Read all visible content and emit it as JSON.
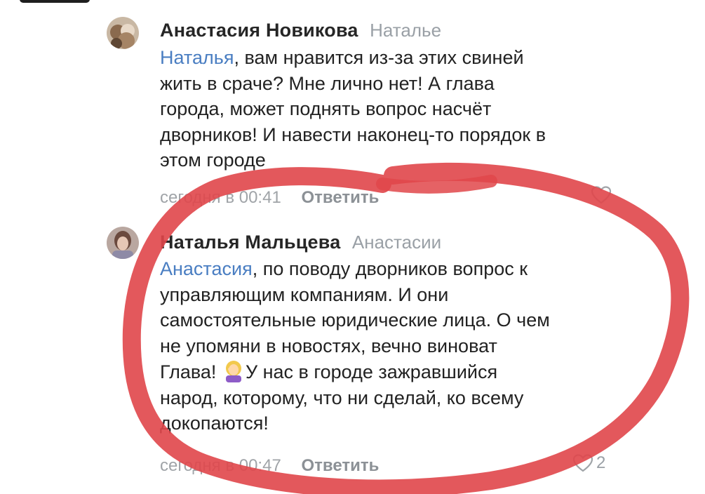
{
  "comments": [
    {
      "author": "Анастасия Новикова",
      "reply_to": "Наталье",
      "mention": "Наталья",
      "lines_first": ", вам нравится из-за этих свиней",
      "lines": [
        "жить в сраче? Мне лично нет! А глава",
        "города, может поднять вопрос насчёт",
        "дворников! И навести наконец-то порядок в",
        "этом городе"
      ],
      "timestamp": "сегодня в 00:41",
      "reply_label": "Ответить",
      "likes": ""
    },
    {
      "author": "Наталья Мальцева",
      "reply_to": "Анастасии",
      "mention": "Анастасия",
      "lines_first": ", по поводу дворников вопрос к",
      "lines": [
        "управляющим компаниям. И они",
        "самостоятельные юридические лица. О чем",
        "не упомяни в новостях, вечно виноват"
      ],
      "line_emoji_before": "Глава! ",
      "line_emoji_after": "У нас в городе зажравшийся",
      "lines_end": [
        "народ, которому, что ни сделай, ко всему",
        "докопаются!"
      ],
      "timestamp": "сегодня в 00:47",
      "reply_label": "Ответить",
      "likes": "2"
    }
  ],
  "annotation": {
    "color": "#e0464a"
  }
}
